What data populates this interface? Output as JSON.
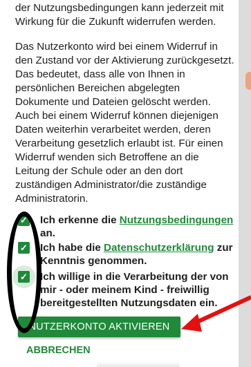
{
  "body_text": {
    "line1": "der Nutzungsbedingungen kann jederzeit mit",
    "line2": "Wirkung für die Zukunft widerrufen werden.",
    "paragraph2": "Das Nutzerkonto wird bei einem Widerruf in den Zustand vor der Aktivierung zurückgesetzt. Das bedeutet, dass alle von Ihnen in persönlichen Bereichen abgelegten Dokumente und Dateien gelöscht werden. Auch bei einem Widerruf können diejenigen Daten weiterhin verarbeitet werden, deren Verarbeitung gesetzlich erlaubt ist. Für einen Widerruf wenden sich Betroffene an die Leitung der Schule oder an den dort zuständigen Administrator/die zuständige Administratorin."
  },
  "checkboxes": [
    {
      "checked": true,
      "prefix": "Ich erkenne die ",
      "link": "Nutzungsbedingungen",
      "suffix": " an.",
      "visible_prefix": "I",
      "visible_after_link_line2": "an"
    },
    {
      "checked": true,
      "prefix": "Ich habe die ",
      "link": "Datenschutzerklärung",
      "suffix": " zur Kenntnis genommen."
    },
    {
      "checked": true,
      "text": "Ich willige in die Verarbeitung der von mir - oder meinem Kind - freiwillig bereitgestellten Nutzungsdaten ein."
    }
  ],
  "actions": {
    "primary": "NUTZERKONTO AKTIVIEREN",
    "secondary": "ABBRECHEN"
  },
  "colors": {
    "accent": "#1f8a3a",
    "annotation_circle": "#000000",
    "annotation_arrow": "#e41010"
  },
  "icons": {
    "checkbox": "check-icon"
  }
}
